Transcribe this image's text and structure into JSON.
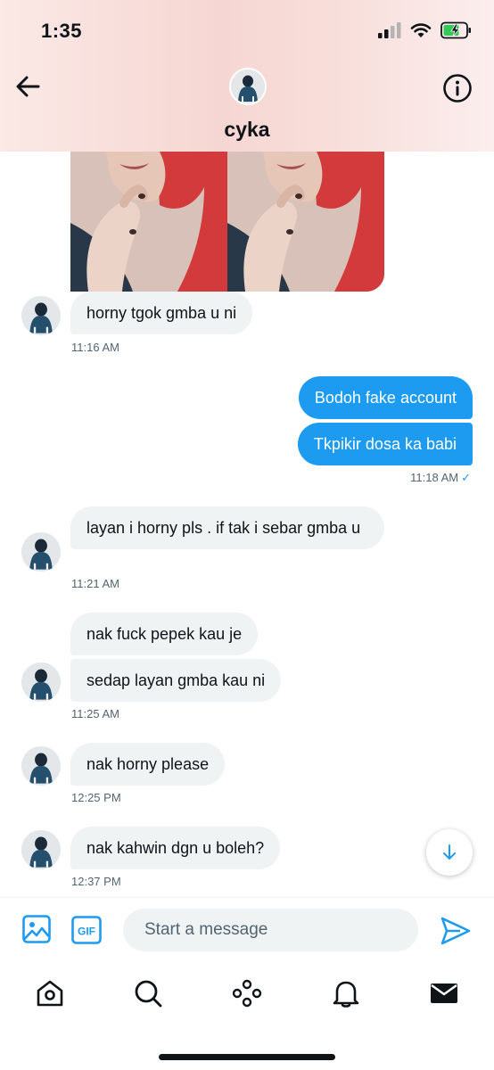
{
  "status": {
    "time": "1:35"
  },
  "header": {
    "name": "cyka"
  },
  "messages": [
    {
      "side": "in",
      "text": "horny tgok gmba u ni",
      "time": "11:16 AM"
    },
    {
      "side": "out",
      "text": "Bodoh fake account"
    },
    {
      "side": "out",
      "text": "Tkpikir dosa ka babi",
      "time": "11:18 AM"
    },
    {
      "side": "in",
      "text": "layan i horny pls . if tak i sebar gmba u",
      "time": "11:21 AM"
    },
    {
      "side": "in",
      "text": "nak fuck pepek kau je"
    },
    {
      "side": "in",
      "text": "sedap layan gmba kau ni",
      "time": "11:25 AM"
    },
    {
      "side": "in",
      "text": "nak horny please",
      "time": "12:25 PM"
    },
    {
      "side": "in",
      "text": "nak kahwin dgn u boleh?",
      "time": "12:37 PM"
    }
  ],
  "composer": {
    "placeholder": "Start a message",
    "gif_label": "GIF"
  },
  "colors": {
    "accent": "#1d9bf0",
    "bubble_in": "#eff3f4",
    "header_tint": "#f6d6d2"
  }
}
